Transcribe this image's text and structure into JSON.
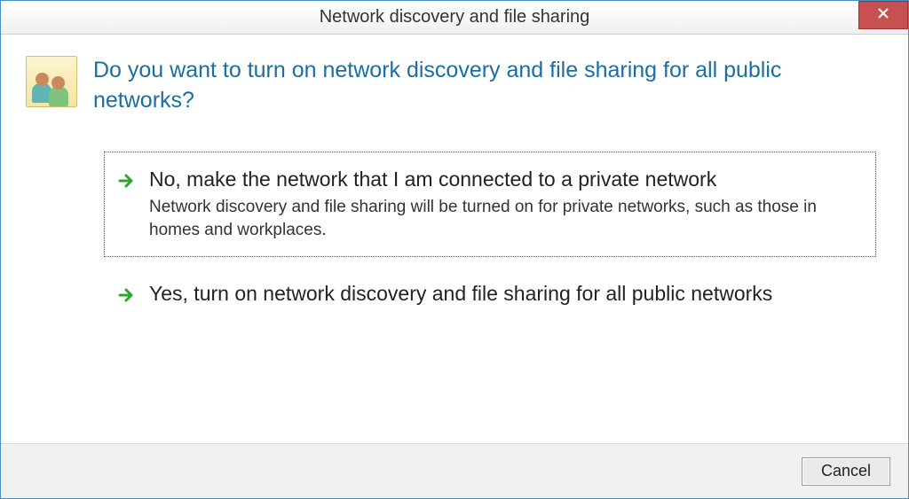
{
  "window": {
    "title": "Network discovery and file sharing"
  },
  "question": "Do you want to turn on network discovery and file sharing for all public networks?",
  "options": [
    {
      "title": "No, make the network that I am connected to a private network",
      "description": "Network discovery and file sharing will be turned on for private networks, such as those in homes and workplaces.",
      "focused": true
    },
    {
      "title": "Yes, turn on network discovery and file sharing for all public networks",
      "description": "",
      "focused": false
    }
  ],
  "footer": {
    "cancel_label": "Cancel"
  }
}
